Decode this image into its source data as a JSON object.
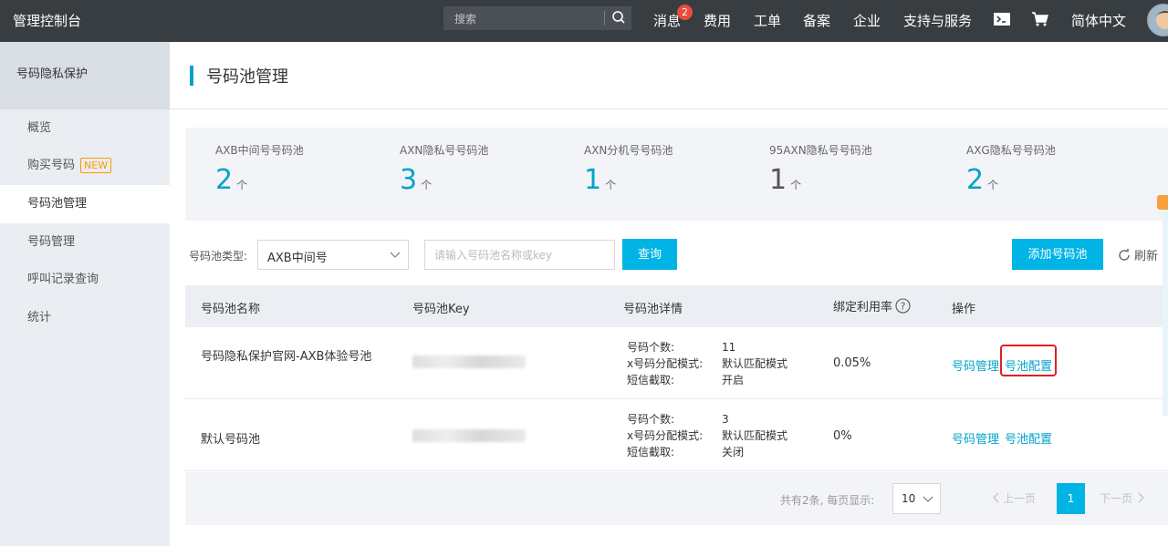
{
  "topbar": {
    "brand": "管理控制台",
    "search_placeholder": "搜索",
    "nav": {
      "messages": "消息",
      "messages_badge": "2",
      "fees": "费用",
      "tickets": "工单",
      "filing": "备案",
      "enterprise": "企业",
      "support": "支持与服务",
      "language": "简体中文"
    }
  },
  "sidebar": {
    "title": "号码隐私保护",
    "items": [
      {
        "label": "概览"
      },
      {
        "label": "购买号码",
        "tag": "NEW"
      },
      {
        "label": "号码池管理"
      },
      {
        "label": "号码管理"
      },
      {
        "label": "呼叫记录查询"
      },
      {
        "label": "统计"
      }
    ]
  },
  "page": {
    "title": "号码池管理",
    "stats": [
      {
        "label": "AXB中间号号码池",
        "count": "2",
        "unit": "个"
      },
      {
        "label": "AXN隐私号号码池",
        "count": "3",
        "unit": "个"
      },
      {
        "label": "AXN分机号号码池",
        "count": "1",
        "unit": "个"
      },
      {
        "label": "95AXN隐私号号码池",
        "count": "1",
        "unit": "个"
      },
      {
        "label": "AXG隐私号号码池",
        "count": "2",
        "unit": "个"
      }
    ],
    "filter": {
      "type_label": "号码池类型:",
      "type_value": "AXB中间号",
      "search_placeholder": "请输入号码池名称或key",
      "query_button": "查询",
      "add_button": "添加号码池",
      "refresh": "刷新"
    },
    "table": {
      "columns": [
        "号码池名称",
        "号码池Key",
        "号码池详情",
        "绑定利用率",
        "操作"
      ],
      "rows": [
        {
          "name": "号码隐私保护官网-AXB体验号池",
          "detail_keys": [
            "号码个数:",
            "x号码分配模式:",
            "短信截取:"
          ],
          "detail_values": [
            "11",
            "默认匹配模式",
            "开启"
          ],
          "utilization": "0.05%",
          "actions": [
            "号码管理",
            "号池配置"
          ]
        },
        {
          "name": "默认号码池",
          "detail_keys": [
            "号码个数:",
            "x号码分配模式:",
            "短信截取:"
          ],
          "detail_values": [
            "3",
            "默认匹配模式",
            "关闭"
          ],
          "utilization": "0%",
          "actions": [
            "号码管理",
            "号池配置"
          ]
        }
      ]
    },
    "pager": {
      "total": "共有2条, 每页显示:",
      "page_size": "10",
      "prev": "上一页",
      "current": "1",
      "next": "下一页"
    }
  },
  "colors": {
    "accent": "#00a2ca",
    "button": "#00b4e6",
    "topbar": "#373d41",
    "highlight": "#e02020"
  }
}
